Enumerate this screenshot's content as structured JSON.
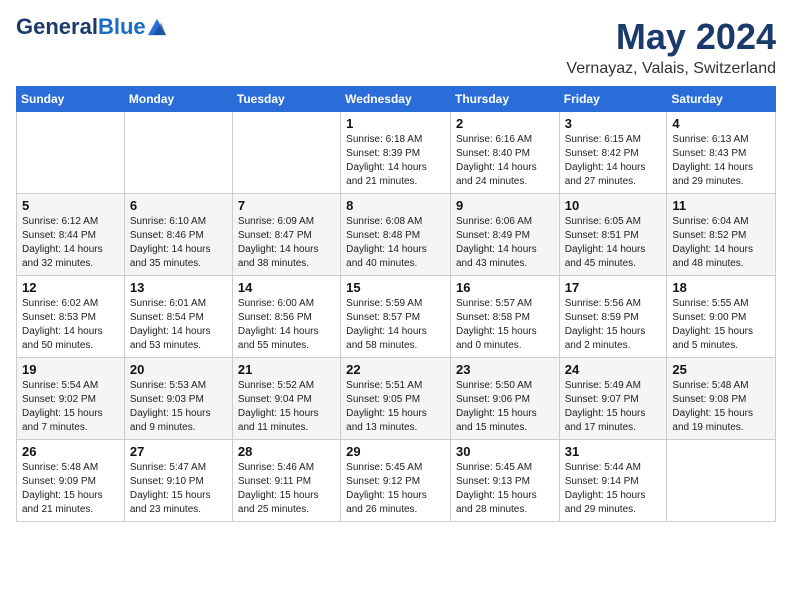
{
  "header": {
    "logo_general": "General",
    "logo_blue": "Blue",
    "title": "May 2024",
    "subtitle": "Vernayaz, Valais, Switzerland"
  },
  "calendar": {
    "days_of_week": [
      "Sunday",
      "Monday",
      "Tuesday",
      "Wednesday",
      "Thursday",
      "Friday",
      "Saturday"
    ],
    "weeks": [
      {
        "row_class": "row-odd",
        "days": [
          {
            "num": "",
            "info": ""
          },
          {
            "num": "",
            "info": ""
          },
          {
            "num": "",
            "info": ""
          },
          {
            "num": "1",
            "info": "Sunrise: 6:18 AM\nSunset: 8:39 PM\nDaylight: 14 hours\nand 21 minutes."
          },
          {
            "num": "2",
            "info": "Sunrise: 6:16 AM\nSunset: 8:40 PM\nDaylight: 14 hours\nand 24 minutes."
          },
          {
            "num": "3",
            "info": "Sunrise: 6:15 AM\nSunset: 8:42 PM\nDaylight: 14 hours\nand 27 minutes."
          },
          {
            "num": "4",
            "info": "Sunrise: 6:13 AM\nSunset: 8:43 PM\nDaylight: 14 hours\nand 29 minutes."
          }
        ]
      },
      {
        "row_class": "row-even",
        "days": [
          {
            "num": "5",
            "info": "Sunrise: 6:12 AM\nSunset: 8:44 PM\nDaylight: 14 hours\nand 32 minutes."
          },
          {
            "num": "6",
            "info": "Sunrise: 6:10 AM\nSunset: 8:46 PM\nDaylight: 14 hours\nand 35 minutes."
          },
          {
            "num": "7",
            "info": "Sunrise: 6:09 AM\nSunset: 8:47 PM\nDaylight: 14 hours\nand 38 minutes."
          },
          {
            "num": "8",
            "info": "Sunrise: 6:08 AM\nSunset: 8:48 PM\nDaylight: 14 hours\nand 40 minutes."
          },
          {
            "num": "9",
            "info": "Sunrise: 6:06 AM\nSunset: 8:49 PM\nDaylight: 14 hours\nand 43 minutes."
          },
          {
            "num": "10",
            "info": "Sunrise: 6:05 AM\nSunset: 8:51 PM\nDaylight: 14 hours\nand 45 minutes."
          },
          {
            "num": "11",
            "info": "Sunrise: 6:04 AM\nSunset: 8:52 PM\nDaylight: 14 hours\nand 48 minutes."
          }
        ]
      },
      {
        "row_class": "row-odd",
        "days": [
          {
            "num": "12",
            "info": "Sunrise: 6:02 AM\nSunset: 8:53 PM\nDaylight: 14 hours\nand 50 minutes."
          },
          {
            "num": "13",
            "info": "Sunrise: 6:01 AM\nSunset: 8:54 PM\nDaylight: 14 hours\nand 53 minutes."
          },
          {
            "num": "14",
            "info": "Sunrise: 6:00 AM\nSunset: 8:56 PM\nDaylight: 14 hours\nand 55 minutes."
          },
          {
            "num": "15",
            "info": "Sunrise: 5:59 AM\nSunset: 8:57 PM\nDaylight: 14 hours\nand 58 minutes."
          },
          {
            "num": "16",
            "info": "Sunrise: 5:57 AM\nSunset: 8:58 PM\nDaylight: 15 hours\nand 0 minutes."
          },
          {
            "num": "17",
            "info": "Sunrise: 5:56 AM\nSunset: 8:59 PM\nDaylight: 15 hours\nand 2 minutes."
          },
          {
            "num": "18",
            "info": "Sunrise: 5:55 AM\nSunset: 9:00 PM\nDaylight: 15 hours\nand 5 minutes."
          }
        ]
      },
      {
        "row_class": "row-even",
        "days": [
          {
            "num": "19",
            "info": "Sunrise: 5:54 AM\nSunset: 9:02 PM\nDaylight: 15 hours\nand 7 minutes."
          },
          {
            "num": "20",
            "info": "Sunrise: 5:53 AM\nSunset: 9:03 PM\nDaylight: 15 hours\nand 9 minutes."
          },
          {
            "num": "21",
            "info": "Sunrise: 5:52 AM\nSunset: 9:04 PM\nDaylight: 15 hours\nand 11 minutes."
          },
          {
            "num": "22",
            "info": "Sunrise: 5:51 AM\nSunset: 9:05 PM\nDaylight: 15 hours\nand 13 minutes."
          },
          {
            "num": "23",
            "info": "Sunrise: 5:50 AM\nSunset: 9:06 PM\nDaylight: 15 hours\nand 15 minutes."
          },
          {
            "num": "24",
            "info": "Sunrise: 5:49 AM\nSunset: 9:07 PM\nDaylight: 15 hours\nand 17 minutes."
          },
          {
            "num": "25",
            "info": "Sunrise: 5:48 AM\nSunset: 9:08 PM\nDaylight: 15 hours\nand 19 minutes."
          }
        ]
      },
      {
        "row_class": "row-odd",
        "days": [
          {
            "num": "26",
            "info": "Sunrise: 5:48 AM\nSunset: 9:09 PM\nDaylight: 15 hours\nand 21 minutes."
          },
          {
            "num": "27",
            "info": "Sunrise: 5:47 AM\nSunset: 9:10 PM\nDaylight: 15 hours\nand 23 minutes."
          },
          {
            "num": "28",
            "info": "Sunrise: 5:46 AM\nSunset: 9:11 PM\nDaylight: 15 hours\nand 25 minutes."
          },
          {
            "num": "29",
            "info": "Sunrise: 5:45 AM\nSunset: 9:12 PM\nDaylight: 15 hours\nand 26 minutes."
          },
          {
            "num": "30",
            "info": "Sunrise: 5:45 AM\nSunset: 9:13 PM\nDaylight: 15 hours\nand 28 minutes."
          },
          {
            "num": "31",
            "info": "Sunrise: 5:44 AM\nSunset: 9:14 PM\nDaylight: 15 hours\nand 29 minutes."
          },
          {
            "num": "",
            "info": ""
          }
        ]
      }
    ]
  }
}
